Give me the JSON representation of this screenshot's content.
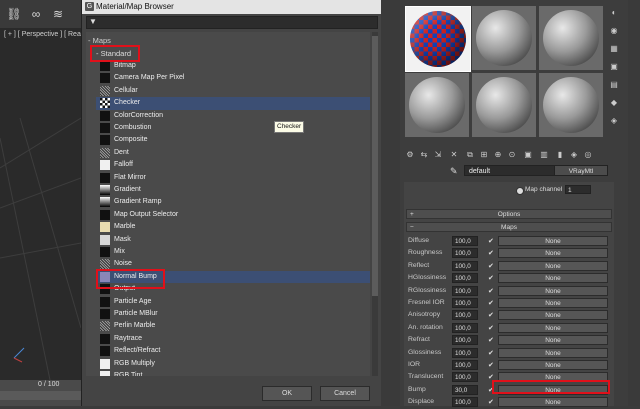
{
  "toolbar": {
    "icons": [
      "link-icon",
      "unlink-icon",
      "bind-icon"
    ]
  },
  "viewport": {
    "label": "[ + ] [ Perspective ] [ Rea"
  },
  "timeline": {
    "frame": "0 / 100"
  },
  "dialog": {
    "title": "Material/Map Browser",
    "search_placeholder": "",
    "maps_header": "- Maps",
    "standard_header": "- Standard",
    "items": [
      {
        "label": "Bitmap",
        "swatch": "black"
      },
      {
        "label": "Camera Map Per Pixel",
        "swatch": "black"
      },
      {
        "label": "Cellular",
        "swatch": "noise"
      },
      {
        "label": "Checker",
        "swatch": "checker"
      },
      {
        "label": "ColorCorrection",
        "swatch": "black"
      },
      {
        "label": "Combustion",
        "swatch": "black"
      },
      {
        "label": "Composite",
        "swatch": "black"
      },
      {
        "label": "Dent",
        "swatch": "noise"
      },
      {
        "label": "Falloff",
        "swatch": "white"
      },
      {
        "label": "Flat Mirror",
        "swatch": "black"
      },
      {
        "label": "Gradient",
        "swatch": "grad"
      },
      {
        "label": "Gradient Ramp",
        "swatch": "grad"
      },
      {
        "label": "Map Output Selector",
        "swatch": "black"
      },
      {
        "label": "Marble",
        "swatch": "yellow"
      },
      {
        "label": "Mask",
        "swatch": "light"
      },
      {
        "label": "Mix",
        "swatch": "black"
      },
      {
        "label": "Noise",
        "swatch": "noise"
      },
      {
        "label": "Normal Bump",
        "swatch": "purple"
      },
      {
        "label": "Output",
        "swatch": "black"
      },
      {
        "label": "Particle Age",
        "swatch": "black"
      },
      {
        "label": "Particle MBlur",
        "swatch": "black"
      },
      {
        "label": "Perlin Marble",
        "swatch": "noise"
      },
      {
        "label": "Raytrace",
        "swatch": "black"
      },
      {
        "label": "Reflect/Refract",
        "swatch": "black"
      },
      {
        "label": "RGB Multiply",
        "swatch": "white"
      },
      {
        "label": "RGB Tint",
        "swatch": "white"
      }
    ],
    "tooltip": "Checker",
    "ok_label": "OK",
    "cancel_label": "Cancel"
  },
  "material_editor": {
    "material_name": "default",
    "material_type": "VRayMtl",
    "map_channel_label": "Map channel",
    "map_channel_value": "1",
    "options_rollout": "Options",
    "maps_rollout": "Maps",
    "rows": [
      {
        "name": "Diffuse",
        "value": "100,0",
        "map": "None"
      },
      {
        "name": "Roughness",
        "value": "100,0",
        "map": "None"
      },
      {
        "name": "Reflect",
        "value": "100,0",
        "map": "None"
      },
      {
        "name": "HGlossiness",
        "value": "100,0",
        "map": "None"
      },
      {
        "name": "RGlossiness",
        "value": "100,0",
        "map": "None"
      },
      {
        "name": "Fresnel IOR",
        "value": "100,0",
        "map": "None"
      },
      {
        "name": "Anisotropy",
        "value": "100,0",
        "map": "None"
      },
      {
        "name": "An. rotation",
        "value": "100,0",
        "map": "None"
      },
      {
        "name": "Refract",
        "value": "100,0",
        "map": "None"
      },
      {
        "name": "Glossiness",
        "value": "100,0",
        "map": "None"
      },
      {
        "name": "IOR",
        "value": "100,0",
        "map": "None"
      },
      {
        "name": "Translucent",
        "value": "100,0",
        "map": "None"
      },
      {
        "name": "Bump",
        "value": "30,0",
        "map": "None"
      },
      {
        "name": "Displace",
        "value": "100,0",
        "map": "None"
      }
    ]
  },
  "colors": {
    "highlight": "#e0101a",
    "selection": "#3c4f74"
  }
}
